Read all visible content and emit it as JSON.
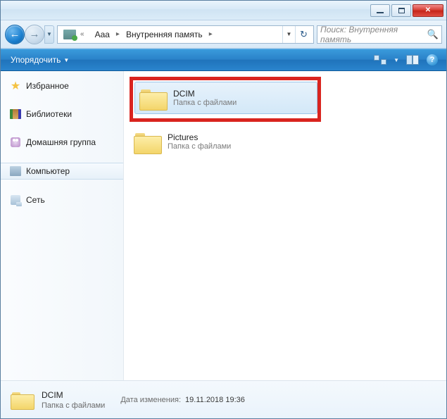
{
  "titlebar": {},
  "nav": {
    "back": "←",
    "forward": "→",
    "breadcrumb": {
      "root_sep": "«",
      "item1": "Aaa",
      "item2": "Внутренняя память"
    },
    "search_placeholder": "Поиск: Внутренняя память"
  },
  "toolbar": {
    "organize": "Упорядочить"
  },
  "sidebar": {
    "favorites": "Избранное",
    "libraries": "Библиотеки",
    "homegroup": "Домашняя группа",
    "computer": "Компьютер",
    "network": "Сеть"
  },
  "items": [
    {
      "name": "DCIM",
      "sub": "Папка с файлами",
      "selected": true,
      "highlighted": true
    },
    {
      "name": "Pictures",
      "sub": "Папка с файлами",
      "selected": false,
      "highlighted": false
    }
  ],
  "details": {
    "name": "DCIM",
    "sub": "Папка с файлами",
    "modified_label": "Дата изменения:",
    "modified_value": "19.11.2018 19:36"
  }
}
